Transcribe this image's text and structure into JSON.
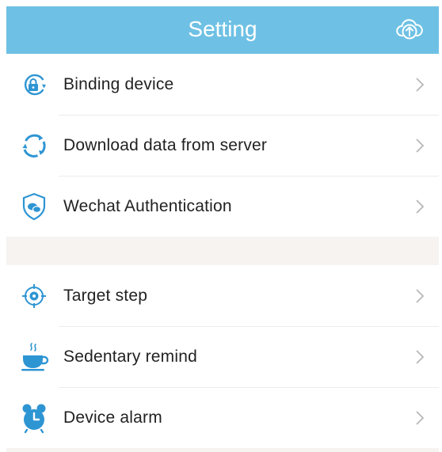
{
  "header": {
    "title": "Setting",
    "upload_icon": "cloud-upload-icon"
  },
  "colors": {
    "header_bg": "#6ec1e4",
    "icon_accent": "#2e95d3",
    "separator_bg": "#f6f3f1",
    "chevron": "#b8b8b8"
  },
  "groups": [
    {
      "items": [
        {
          "label": "Binding device",
          "icon": "binding-device-icon"
        },
        {
          "label": "Download data from server",
          "icon": "sync-icon"
        },
        {
          "label": "Wechat Authentication",
          "icon": "shield-icon"
        }
      ]
    },
    {
      "items": [
        {
          "label": "Target step",
          "icon": "target-icon"
        },
        {
          "label": "Sedentary remind",
          "icon": "coffee-cup-icon"
        },
        {
          "label": "Device alarm",
          "icon": "alarm-clock-icon"
        }
      ]
    }
  ]
}
